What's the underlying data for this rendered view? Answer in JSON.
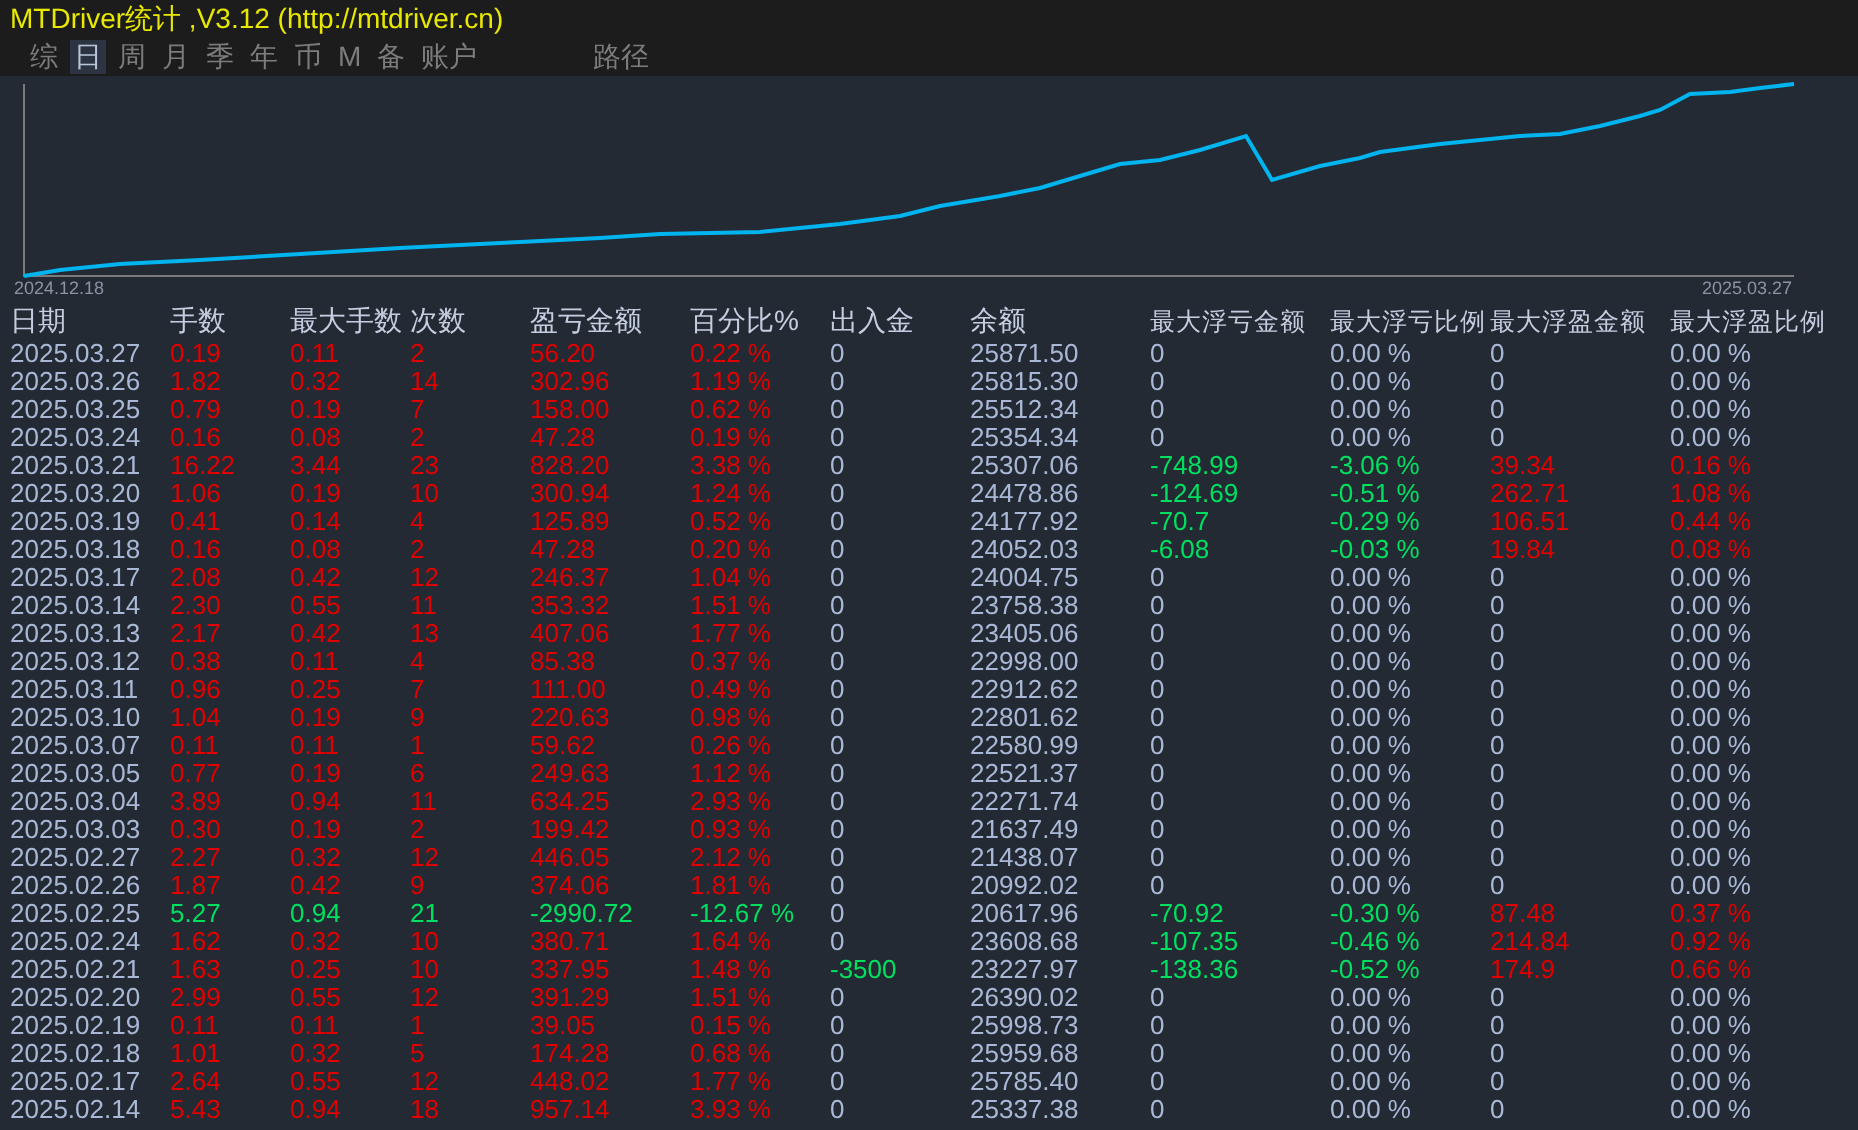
{
  "window": {
    "title": "MTDriver统计 ,V3.12 (http://mtdriver.cn)"
  },
  "tabs": [
    {
      "label": "综",
      "selected": false
    },
    {
      "label": "日",
      "selected": true
    },
    {
      "label": "周",
      "selected": false
    },
    {
      "label": "月",
      "selected": false
    },
    {
      "label": "季",
      "selected": false
    },
    {
      "label": "年",
      "selected": false
    },
    {
      "label": "币",
      "selected": false
    },
    {
      "label": "M",
      "selected": false
    },
    {
      "label": "备",
      "selected": false
    },
    {
      "label": "账户",
      "selected": false
    },
    {
      "label": "路径",
      "selected": false
    }
  ],
  "chart": {
    "start_label": "2024.12.18",
    "end_label": "2025.03.27"
  },
  "table": {
    "columns": [
      "日期",
      "手数",
      "最大手数",
      "次数",
      "盈亏金额",
      "百分比%",
      "出入金",
      "余额",
      "最大浮亏金额",
      "最大浮亏比例",
      "最大浮盈金额",
      "最大浮盈比例"
    ],
    "rows": [
      {
        "cells": [
          "2025.03.27",
          "0.19",
          "0.11",
          "2",
          "56.20",
          "0.22 %",
          "0",
          "25871.50",
          "0",
          "0.00 %",
          "0",
          "0.00 %"
        ],
        "loss": false,
        "withdrawal": false,
        "floating": false
      },
      {
        "cells": [
          "2025.03.26",
          "1.82",
          "0.32",
          "14",
          "302.96",
          "1.19 %",
          "0",
          "25815.30",
          "0",
          "0.00 %",
          "0",
          "0.00 %"
        ],
        "loss": false,
        "withdrawal": false,
        "floating": false
      },
      {
        "cells": [
          "2025.03.25",
          "0.79",
          "0.19",
          "7",
          "158.00",
          "0.62 %",
          "0",
          "25512.34",
          "0",
          "0.00 %",
          "0",
          "0.00 %"
        ],
        "loss": false,
        "withdrawal": false,
        "floating": false
      },
      {
        "cells": [
          "2025.03.24",
          "0.16",
          "0.08",
          "2",
          "47.28",
          "0.19 %",
          "0",
          "25354.34",
          "0",
          "0.00 %",
          "0",
          "0.00 %"
        ],
        "loss": false,
        "withdrawal": false,
        "floating": false
      },
      {
        "cells": [
          "2025.03.21",
          "16.22",
          "3.44",
          "23",
          "828.20",
          "3.38 %",
          "0",
          "25307.06",
          "-748.99",
          "-3.06 %",
          "39.34",
          "0.16 %"
        ],
        "loss": false,
        "withdrawal": false,
        "floating": true
      },
      {
        "cells": [
          "2025.03.20",
          "1.06",
          "0.19",
          "10",
          "300.94",
          "1.24 %",
          "0",
          "24478.86",
          "-124.69",
          "-0.51 %",
          "262.71",
          "1.08 %"
        ],
        "loss": false,
        "withdrawal": false,
        "floating": true
      },
      {
        "cells": [
          "2025.03.19",
          "0.41",
          "0.14",
          "4",
          "125.89",
          "0.52 %",
          "0",
          "24177.92",
          "-70.7",
          "-0.29 %",
          "106.51",
          "0.44 %"
        ],
        "loss": false,
        "withdrawal": false,
        "floating": true
      },
      {
        "cells": [
          "2025.03.18",
          "0.16",
          "0.08",
          "2",
          "47.28",
          "0.20 %",
          "0",
          "24052.03",
          "-6.08",
          "-0.03 %",
          "19.84",
          "0.08 %"
        ],
        "loss": false,
        "withdrawal": false,
        "floating": true
      },
      {
        "cells": [
          "2025.03.17",
          "2.08",
          "0.42",
          "12",
          "246.37",
          "1.04 %",
          "0",
          "24004.75",
          "0",
          "0.00 %",
          "0",
          "0.00 %"
        ],
        "loss": false,
        "withdrawal": false,
        "floating": false
      },
      {
        "cells": [
          "2025.03.14",
          "2.30",
          "0.55",
          "11",
          "353.32",
          "1.51 %",
          "0",
          "23758.38",
          "0",
          "0.00 %",
          "0",
          "0.00 %"
        ],
        "loss": false,
        "withdrawal": false,
        "floating": false
      },
      {
        "cells": [
          "2025.03.13",
          "2.17",
          "0.42",
          "13",
          "407.06",
          "1.77 %",
          "0",
          "23405.06",
          "0",
          "0.00 %",
          "0",
          "0.00 %"
        ],
        "loss": false,
        "withdrawal": false,
        "floating": false
      },
      {
        "cells": [
          "2025.03.12",
          "0.38",
          "0.11",
          "4",
          "85.38",
          "0.37 %",
          "0",
          "22998.00",
          "0",
          "0.00 %",
          "0",
          "0.00 %"
        ],
        "loss": false,
        "withdrawal": false,
        "floating": false
      },
      {
        "cells": [
          "2025.03.11",
          "0.96",
          "0.25",
          "7",
          "111.00",
          "0.49 %",
          "0",
          "22912.62",
          "0",
          "0.00 %",
          "0",
          "0.00 %"
        ],
        "loss": false,
        "withdrawal": false,
        "floating": false
      },
      {
        "cells": [
          "2025.03.10",
          "1.04",
          "0.19",
          "9",
          "220.63",
          "0.98 %",
          "0",
          "22801.62",
          "0",
          "0.00 %",
          "0",
          "0.00 %"
        ],
        "loss": false,
        "withdrawal": false,
        "floating": false
      },
      {
        "cells": [
          "2025.03.07",
          "0.11",
          "0.11",
          "1",
          "59.62",
          "0.26 %",
          "0",
          "22580.99",
          "0",
          "0.00 %",
          "0",
          "0.00 %"
        ],
        "loss": false,
        "withdrawal": false,
        "floating": false
      },
      {
        "cells": [
          "2025.03.05",
          "0.77",
          "0.19",
          "6",
          "249.63",
          "1.12 %",
          "0",
          "22521.37",
          "0",
          "0.00 %",
          "0",
          "0.00 %"
        ],
        "loss": false,
        "withdrawal": false,
        "floating": false
      },
      {
        "cells": [
          "2025.03.04",
          "3.89",
          "0.94",
          "11",
          "634.25",
          "2.93 %",
          "0",
          "22271.74",
          "0",
          "0.00 %",
          "0",
          "0.00 %"
        ],
        "loss": false,
        "withdrawal": false,
        "floating": false
      },
      {
        "cells": [
          "2025.03.03",
          "0.30",
          "0.19",
          "2",
          "199.42",
          "0.93 %",
          "0",
          "21637.49",
          "0",
          "0.00 %",
          "0",
          "0.00 %"
        ],
        "loss": false,
        "withdrawal": false,
        "floating": false
      },
      {
        "cells": [
          "2025.02.27",
          "2.27",
          "0.32",
          "12",
          "446.05",
          "2.12 %",
          "0",
          "21438.07",
          "0",
          "0.00 %",
          "0",
          "0.00 %"
        ],
        "loss": false,
        "withdrawal": false,
        "floating": false
      },
      {
        "cells": [
          "2025.02.26",
          "1.87",
          "0.42",
          "9",
          "374.06",
          "1.81 %",
          "0",
          "20992.02",
          "0",
          "0.00 %",
          "0",
          "0.00 %"
        ],
        "loss": false,
        "withdrawal": false,
        "floating": false
      },
      {
        "cells": [
          "2025.02.25",
          "5.27",
          "0.94",
          "21",
          "-2990.72",
          "-12.67 %",
          "0",
          "20617.96",
          "-70.92",
          "-0.30 %",
          "87.48",
          "0.37 %"
        ],
        "loss": true,
        "withdrawal": false,
        "floating": true
      },
      {
        "cells": [
          "2025.02.24",
          "1.62",
          "0.32",
          "10",
          "380.71",
          "1.64 %",
          "0",
          "23608.68",
          "-107.35",
          "-0.46 %",
          "214.84",
          "0.92 %"
        ],
        "loss": false,
        "withdrawal": false,
        "floating": true
      },
      {
        "cells": [
          "2025.02.21",
          "1.63",
          "0.25",
          "10",
          "337.95",
          "1.48 %",
          "-3500",
          "23227.97",
          "-138.36",
          "-0.52 %",
          "174.9",
          "0.66 %"
        ],
        "loss": false,
        "withdrawal": true,
        "floating": true
      },
      {
        "cells": [
          "2025.02.20",
          "2.99",
          "0.55",
          "12",
          "391.29",
          "1.51 %",
          "0",
          "26390.02",
          "0",
          "0.00 %",
          "0",
          "0.00 %"
        ],
        "loss": false,
        "withdrawal": false,
        "floating": false
      },
      {
        "cells": [
          "2025.02.19",
          "0.11",
          "0.11",
          "1",
          "39.05",
          "0.15 %",
          "0",
          "25998.73",
          "0",
          "0.00 %",
          "0",
          "0.00 %"
        ],
        "loss": false,
        "withdrawal": false,
        "floating": false
      },
      {
        "cells": [
          "2025.02.18",
          "1.01",
          "0.32",
          "5",
          "174.28",
          "0.68 %",
          "0",
          "25959.68",
          "0",
          "0.00 %",
          "0",
          "0.00 %"
        ],
        "loss": false,
        "withdrawal": false,
        "floating": false
      },
      {
        "cells": [
          "2025.02.17",
          "2.64",
          "0.55",
          "12",
          "448.02",
          "1.77 %",
          "0",
          "25785.40",
          "0",
          "0.00 %",
          "0",
          "0.00 %"
        ],
        "loss": false,
        "withdrawal": false,
        "floating": false
      },
      {
        "cells": [
          "2025.02.14",
          "5.43",
          "0.94",
          "18",
          "957.14",
          "3.93 %",
          "0",
          "25337.38",
          "0",
          "0.00 %",
          "0",
          "0.00 %"
        ],
        "loss": false,
        "withdrawal": false,
        "floating": false
      }
    ]
  }
}
